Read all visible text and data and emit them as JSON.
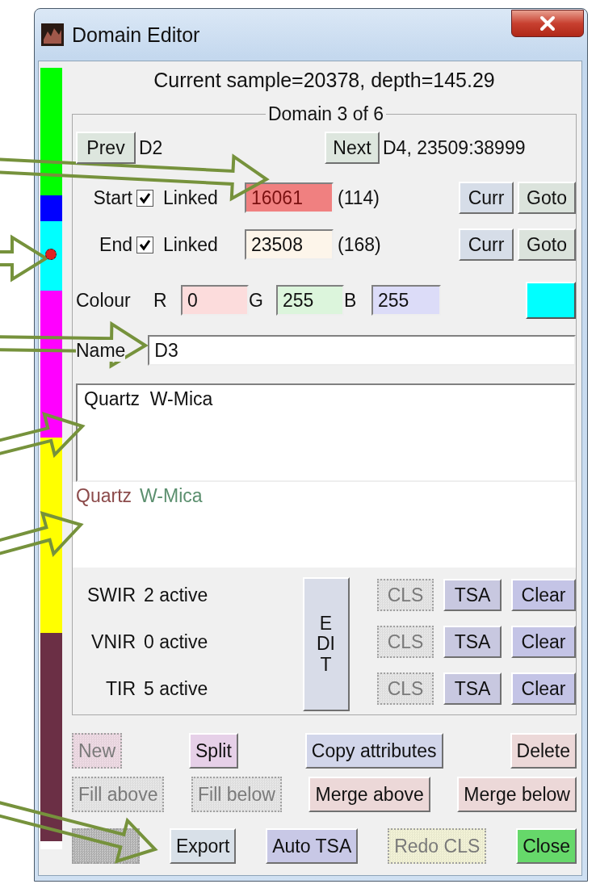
{
  "window": {
    "title": "Domain Editor"
  },
  "domain_bar": {
    "segments": [
      {
        "color": "#00ff00",
        "selected": false
      },
      {
        "color": "#0000ff",
        "selected": false
      },
      {
        "color": "#00ffff",
        "selected": true
      },
      {
        "color": "#ff00ff",
        "selected": false
      },
      {
        "color": "#ffff00",
        "selected": false
      },
      {
        "color": "#6b2f45",
        "selected": false
      }
    ]
  },
  "status_line": "Current sample=20378,  depth=145.29",
  "domain": {
    "title": "Domain 3 of 6",
    "prev": {
      "label": "Prev",
      "color": "#dde6de",
      "disabled": false
    },
    "prev_name": "D2",
    "next": {
      "label": "Next",
      "color": "#dde6de",
      "disabled": false
    },
    "next_info": "D4, 23509:38999",
    "bounds": [
      {
        "label": "Start",
        "checked": true,
        "linked_label": "Linked",
        "value": "16061",
        "color": "#f08080",
        "count": "(114)",
        "buttons": [
          {
            "label": "Curr",
            "color": "#d6dde8",
            "disabled": false
          },
          {
            "label": "Goto",
            "color": "#dbe3dc",
            "disabled": false
          }
        ]
      },
      {
        "label": "End",
        "checked": true,
        "linked_label": "Linked",
        "value": "23508",
        "color": "#fdf5ea",
        "count": "(168)",
        "buttons": [
          {
            "label": "Curr",
            "color": "#d6dde8",
            "disabled": false
          },
          {
            "label": "Goto",
            "color": "#dbe3dc",
            "disabled": false
          }
        ]
      }
    ],
    "colour": {
      "label": "Colour",
      "channels": [
        {
          "label": "R",
          "value": "0",
          "color": "#fcdcdc"
        },
        {
          "label": "G",
          "value": "255",
          "color": "#dcf5dc"
        },
        {
          "label": "B",
          "value": "255",
          "color": "#dcdcf8"
        }
      ],
      "swatch": {
        "color": "#00ffff"
      }
    },
    "name": {
      "label": "Name",
      "value": "D3"
    },
    "notes": {
      "value": "Quartz  W-Mica"
    },
    "minerals": [
      {
        "text": "Quartz",
        "color": "#8c4b4b"
      },
      {
        "text": "W-Mica",
        "color": "#5b8f6e"
      }
    ],
    "sensors": [
      {
        "label": "SWIR",
        "status": "2 active",
        "buttons": [
          {
            "label": "CLS",
            "color": "#e8e8e8",
            "disabled": true
          },
          {
            "label": "TSA",
            "color": "#c8c8e0",
            "disabled": false
          },
          {
            "label": "Clear",
            "color": "#c4c4e6",
            "disabled": false
          }
        ]
      },
      {
        "label": "VNIR",
        "status": "0 active",
        "buttons": [
          {
            "label": "CLS",
            "color": "#e8e8e8",
            "disabled": true
          },
          {
            "label": "TSA",
            "color": "#c8c8e0",
            "disabled": false
          },
          {
            "label": "Clear",
            "color": "#c4c4e6",
            "disabled": false
          }
        ]
      },
      {
        "label": "TIR",
        "status": "5 active",
        "buttons": [
          {
            "label": "CLS",
            "color": "#e8e8e8",
            "disabled": true
          },
          {
            "label": "TSA",
            "color": "#c8c8e0",
            "disabled": false
          },
          {
            "label": "Clear",
            "color": "#c4c4e6",
            "disabled": false
          }
        ]
      }
    ],
    "edit_button": {
      "label": "EDIT",
      "color": "#d8dce8",
      "disabled": false
    }
  },
  "action_rows": [
    {
      "buttons": [
        {
          "label": "New",
          "color": "#f0dce6",
          "disabled": true
        },
        {
          "label": "Split",
          "color": "#e6d0e8",
          "disabled": false
        },
        {
          "label": "Copy attributes",
          "color": "#d2d6ea",
          "disabled": false
        },
        {
          "label": "Delete",
          "color": "#ecd8d8",
          "disabled": false
        }
      ]
    },
    {
      "buttons": [
        {
          "label": "Fill above",
          "color": "#e8e8e8",
          "disabled": true
        },
        {
          "label": "Fill below",
          "color": "#e8e8e8",
          "disabled": true
        },
        {
          "label": "Merge above",
          "color": "#ecd8d8",
          "disabled": false
        },
        {
          "label": "Merge below",
          "color": "#ecd8d8",
          "disabled": false
        }
      ]
    },
    {
      "buttons": [
        {
          "color": "#c8c8c8",
          "disabled": true
        },
        {
          "label": "Export",
          "color": "#d8e0e8",
          "disabled": false
        },
        {
          "label": "Auto TSA",
          "color": "#c8c8e6",
          "disabled": false
        },
        {
          "label": "Redo CLS",
          "color": "#f4f4d8",
          "disabled": true
        },
        {
          "label": "Close",
          "color": "#66d86a",
          "disabled": false
        }
      ]
    }
  ]
}
